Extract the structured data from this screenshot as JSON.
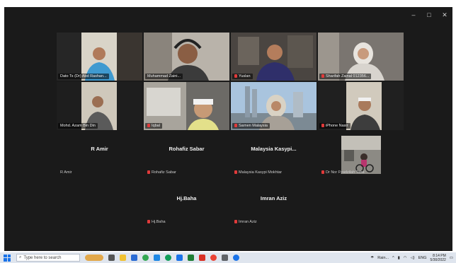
{
  "participants_video": [
    {
      "name": "Dato Ts (Dr) Abd Rashan...",
      "muted": false,
      "active": true
    },
    {
      "name": "Muhammad Zaini...",
      "muted": false,
      "active": false
    },
    {
      "name": "Yuslan",
      "muted": true,
      "active": false
    },
    {
      "name": "Sharifah Zainal 012356...",
      "muted": true,
      "active": false
    },
    {
      "name": "Mohd. Azam Bin Din",
      "muted": false,
      "active": false
    },
    {
      "name": "Iqbal",
      "muted": true,
      "active": false
    },
    {
      "name": "Sarnen Malaysia",
      "muted": true,
      "active": false
    },
    {
      "name": "iPhone Nasir",
      "muted": true,
      "active": false
    }
  ],
  "participants_audio": [
    {
      "display": "R Amir",
      "tag": "R Amir",
      "muted": false
    },
    {
      "display": "Rohafiz Sabar",
      "tag": "Rohafiz Sabar",
      "muted": true
    },
    {
      "display": "Malaysia Kasypi...",
      "tag": "Malaysia Kasypi Mokhtar",
      "muted": true
    },
    {
      "display": "",
      "tag": "Dr Nor Fyadzilah Taha",
      "muted": true
    },
    {
      "display": "Hj.Baha",
      "tag": "Hj.Baha",
      "muted": true
    },
    {
      "display": "Imran Aziz",
      "tag": "Imran Aziz",
      "muted": true
    }
  ],
  "window_controls": {
    "minimize": "–",
    "maximize": "□",
    "close": "✕"
  },
  "taskbar": {
    "search_placeholder": "Type here to search",
    "weather": "Rain...",
    "language": "ENG",
    "time": "8:14 PM",
    "date": "5/30/2022"
  },
  "colors": {
    "active_speaker": "#2ec866",
    "muted": "#e03a3a",
    "zoom_bg": "#1a1a1a"
  }
}
